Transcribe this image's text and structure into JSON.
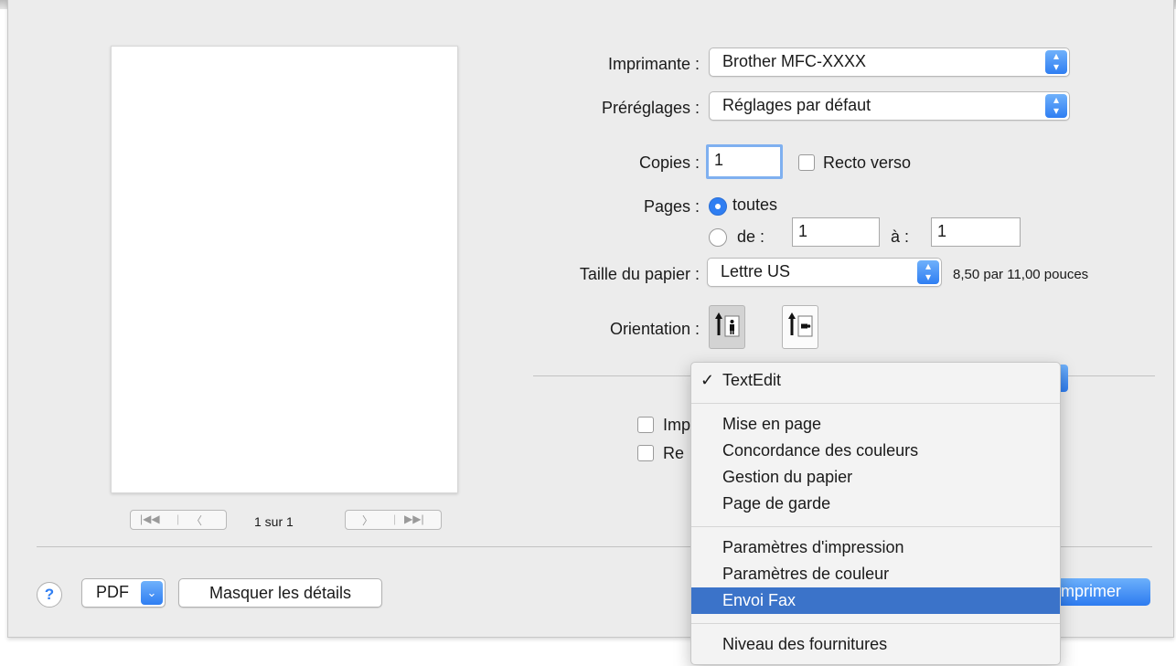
{
  "printer": {
    "label": "Imprimante :",
    "value": "Brother MFC-XXXX"
  },
  "presets": {
    "label": "Préréglages :",
    "value": "Réglages par défaut"
  },
  "copies": {
    "label": "Copies :",
    "value": "1",
    "duplex_label": "Recto verso"
  },
  "pages": {
    "label": "Pages :",
    "all_label": "toutes",
    "from_label": "de :",
    "from_value": "1",
    "to_label": "à :",
    "to_value": "1"
  },
  "paper": {
    "label": "Taille du papier :",
    "value": "Lettre US",
    "dimensions": "8,50 par 11,00 pouces"
  },
  "orientation": {
    "label": "Orientation :"
  },
  "options": {
    "partial_1": "Imp",
    "partial_2": "Re"
  },
  "preview": {
    "page_counter": "1 sur 1",
    "first": "|◀◀",
    "prev": "〈",
    "next": "〉",
    "last": "▶▶|"
  },
  "footer": {
    "help": "?",
    "pdf_label": "PDF",
    "hide_details": "Masquer les détails",
    "print_partial": "mprimer"
  },
  "menu": {
    "check": "✓",
    "groups": [
      [
        "TextEdit"
      ],
      [
        "Mise en page",
        "Concordance des couleurs",
        "Gestion du papier",
        "Page de garde"
      ],
      [
        "Paramètres d'impression",
        "Paramètres de couleur",
        "Envoi Fax"
      ],
      [
        "Niveau des fournitures"
      ]
    ],
    "selected": "TextEdit",
    "highlighted": "Envoi Fax"
  },
  "colors": {
    "accent": "#2f7ef2",
    "highlight": "#3b73c9"
  }
}
